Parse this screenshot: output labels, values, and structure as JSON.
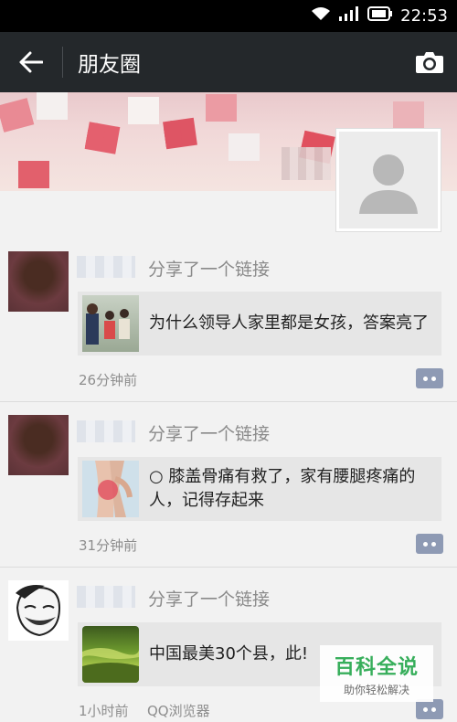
{
  "status_bar": {
    "time": "22:53"
  },
  "app_bar": {
    "title": "朋友圈"
  },
  "posts": [
    {
      "action": "分享了一个链接",
      "link_title": "为什么领导人家里都是女孩，答案亮了",
      "time": "26分钟前",
      "source": ""
    },
    {
      "action": "分享了一个链接",
      "link_title": "○ 膝盖骨痛有救了，家有腰腿疼痛的人，记得存起来",
      "time": "31分钟前",
      "source": ""
    },
    {
      "action": "分享了一个链接",
      "link_title": "中国最美30个县，此!",
      "time": "1小时前",
      "source": "QQ浏览器"
    }
  ],
  "watermark": {
    "main": "百科全说",
    "sub": "助你轻松解决"
  },
  "colors": {
    "app_bar": "#24282b",
    "comment_button": "#8e9ab4",
    "card_bg": "#e6e6e6",
    "watermark_green": "#2eac54"
  }
}
